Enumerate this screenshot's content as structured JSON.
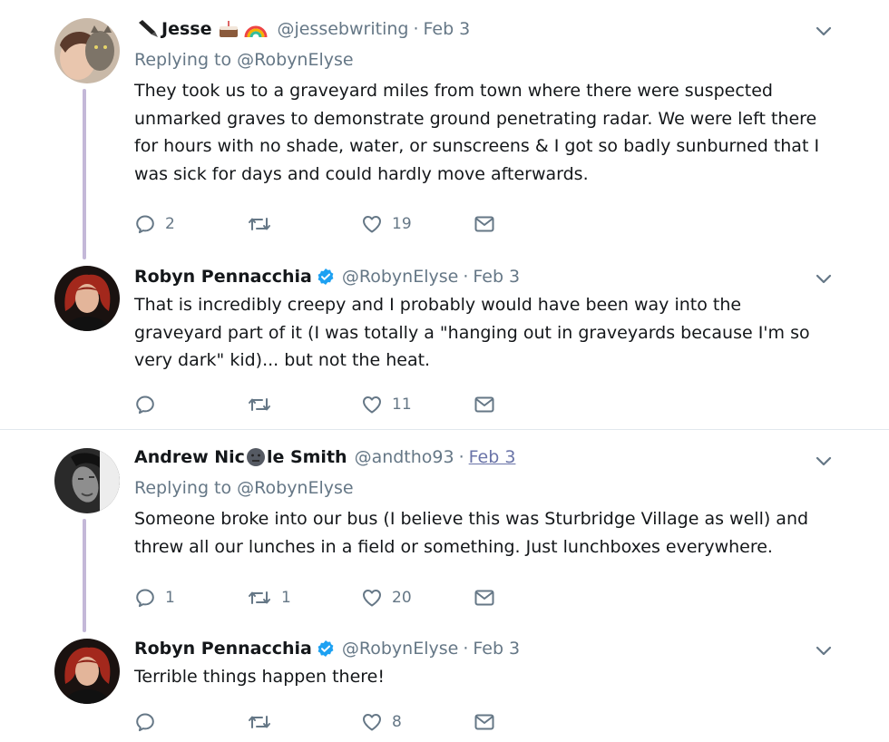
{
  "tweets": [
    {
      "name": "Jesse",
      "handle": "@jessebwriting",
      "time": "Feb 3",
      "replying_prefix": "Replying to ",
      "replying_to": "@RobynElyse",
      "text": "They took us to a graveyard miles from town where there were suspected unmarked graves to demonstrate ground penetrating radar. We were left there for hours with no shade, water, or sunscreens & I got so badly sunburned that I was sick for days and could hardly move afterwards.",
      "replies": "2",
      "retweets": "",
      "likes": "19"
    },
    {
      "name": "Robyn Pennacchia",
      "handle": "@RobynElyse",
      "time": "Feb 3",
      "text": "That is incredibly creepy and I probably would have been way into the graveyard part of it (I was totally a \"hanging out in graveyards because I'm so very dark\" kid)... but not the heat.",
      "replies": "",
      "retweets": "",
      "likes": "11"
    },
    {
      "name_part1": "Andrew Nic",
      "name_part2": "le Smith",
      "handle": "@andtho93",
      "time": "Feb 3",
      "replying_prefix": "Replying to ",
      "replying_to": "@RobynElyse",
      "text": "Someone broke into our bus (I believe this was Sturbridge Village as well) and threw all our lunches in a field or something. Just lunchboxes everywhere.",
      "replies": "1",
      "retweets": "1",
      "likes": "20"
    },
    {
      "name": "Robyn Pennacchia",
      "handle": "@RobynElyse",
      "time": "Feb 3",
      "text": "Terrible things happen there!",
      "replies": "",
      "retweets": "",
      "likes": "8"
    }
  ],
  "icons": [
    "pen-emoji",
    "cake-emoji",
    "rainbow-emoji",
    "verified-badge",
    "reply-icon",
    "retweet-icon",
    "like-icon",
    "message-icon",
    "chevron-down-icon",
    "neutral-face-emoji"
  ]
}
